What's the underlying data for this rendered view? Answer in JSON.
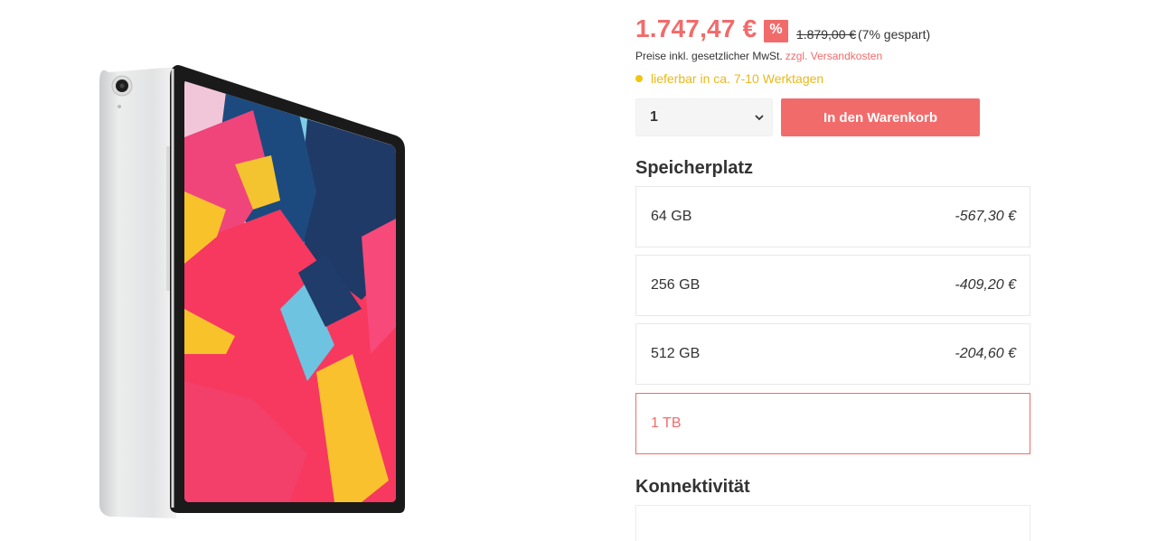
{
  "product": {
    "image_alt": "iPad Pro"
  },
  "pricing": {
    "current_price": "1.747,47 €",
    "badge": "%",
    "old_price": "1.879,00 €",
    "savings": "(7% gespart)",
    "tax_note": "Preise inkl. gesetzlicher MwSt.",
    "shipping_link": "zzgl. Versandkosten"
  },
  "availability": {
    "text": "lieferbar in ca. 7-10 Werktagen",
    "status_color": "#f2c40f"
  },
  "purchase": {
    "quantity": "1",
    "cart_button": "In den Warenkorb"
  },
  "storage": {
    "heading": "Speicherplatz",
    "options": [
      {
        "label": "64 GB",
        "delta": "-567,30 €",
        "selected": false
      },
      {
        "label": "256 GB",
        "delta": "-409,20 €",
        "selected": false
      },
      {
        "label": "512 GB",
        "delta": "-204,60 €",
        "selected": false
      },
      {
        "label": "1 TB",
        "delta": "",
        "selected": true
      }
    ]
  },
  "connectivity": {
    "heading": "Konnektivität"
  },
  "colors": {
    "accent": "#f26b6b",
    "availability": "#e9b81a"
  }
}
